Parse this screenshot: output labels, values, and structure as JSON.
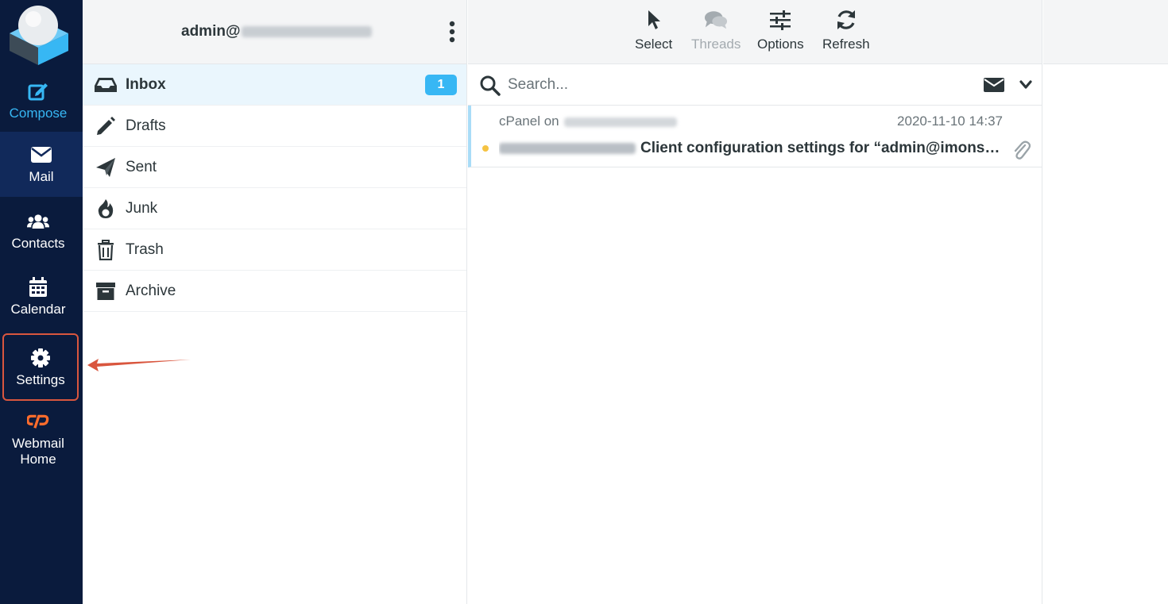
{
  "nav": {
    "compose": "Compose",
    "mail": "Mail",
    "contacts": "Contacts",
    "calendar": "Calendar",
    "settings": "Settings",
    "webmail_home_line1": "Webmail",
    "webmail_home_line2": "Home"
  },
  "account": {
    "prefix": "admin@"
  },
  "folders": [
    {
      "label": "Inbox",
      "icon": "inbox-icon",
      "unread": "1",
      "active": true
    },
    {
      "label": "Drafts",
      "icon": "pencil-icon"
    },
    {
      "label": "Sent",
      "icon": "paper-plane-icon"
    },
    {
      "label": "Junk",
      "icon": "fire-icon"
    },
    {
      "label": "Trash",
      "icon": "trash-icon"
    },
    {
      "label": "Archive",
      "icon": "archive-icon"
    }
  ],
  "toolbar": {
    "select": "Select",
    "threads": "Threads",
    "options": "Options",
    "refresh": "Refresh"
  },
  "search": {
    "placeholder": "Search..."
  },
  "messages": [
    {
      "from_prefix": "cPanel on",
      "date": "2020-11-10 14:37",
      "subject": "Client configuration settings for “admin@imons…",
      "has_attachment": true,
      "unread": true
    }
  ],
  "colors": {
    "rail_bg": "#0a1b3d",
    "accent": "#37b7f4",
    "highlight_box": "#d9563e",
    "cpanel_orange": "#ff6c2c"
  }
}
